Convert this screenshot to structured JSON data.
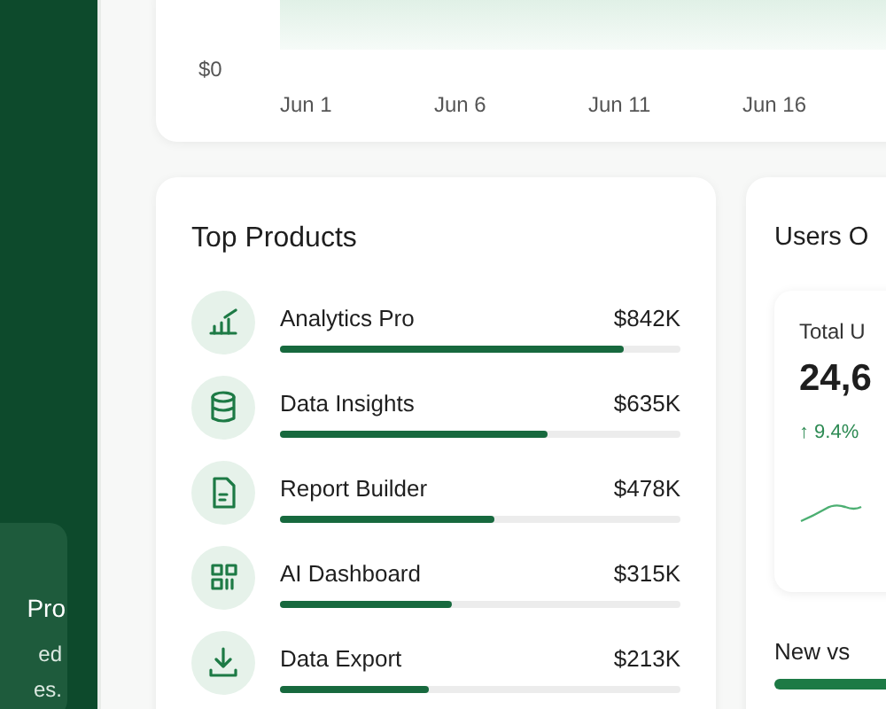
{
  "sidebar": {
    "promo": {
      "title": "Pro",
      "lines": [
        "ed",
        "es."
      ]
    }
  },
  "revenue_chart": {
    "y_label": "$0",
    "x_labels": [
      "Jun 1",
      "Jun 6",
      "Jun 11",
      "Jun 16"
    ]
  },
  "top_products": {
    "title": "Top Products",
    "items": [
      {
        "kind": "chart",
        "name": "Analytics Pro",
        "value": "$842K",
        "level": 0.86
      },
      {
        "kind": "database",
        "name": "Data Insights",
        "value": "$635K",
        "level": 0.67
      },
      {
        "kind": "document",
        "name": "Report Builder",
        "value": "$478K",
        "level": 0.535
      },
      {
        "kind": "grid",
        "name": "AI Dashboard",
        "value": "$315K",
        "level": 0.43
      },
      {
        "kind": "download",
        "name": "Data Export",
        "value": "$213K",
        "level": 0.37
      }
    ]
  },
  "users_overview": {
    "title": "Users O",
    "total_label": "Total U",
    "total_value": "24,6",
    "change": "↑ 9.4%",
    "subtitle": "New vs"
  }
}
